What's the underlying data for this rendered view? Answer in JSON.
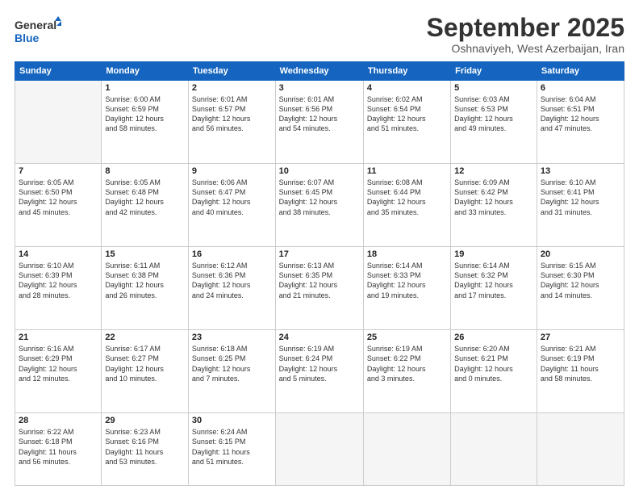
{
  "header": {
    "logo_line1": "General",
    "logo_line2": "Blue",
    "month": "September 2025",
    "location": "Oshnaviyeh, West Azerbaijan, Iran"
  },
  "weekdays": [
    "Sunday",
    "Monday",
    "Tuesday",
    "Wednesday",
    "Thursday",
    "Friday",
    "Saturday"
  ],
  "weeks": [
    [
      {
        "day": "",
        "info": ""
      },
      {
        "day": "1",
        "info": "Sunrise: 6:00 AM\nSunset: 6:59 PM\nDaylight: 12 hours\nand 58 minutes."
      },
      {
        "day": "2",
        "info": "Sunrise: 6:01 AM\nSunset: 6:57 PM\nDaylight: 12 hours\nand 56 minutes."
      },
      {
        "day": "3",
        "info": "Sunrise: 6:01 AM\nSunset: 6:56 PM\nDaylight: 12 hours\nand 54 minutes."
      },
      {
        "day": "4",
        "info": "Sunrise: 6:02 AM\nSunset: 6:54 PM\nDaylight: 12 hours\nand 51 minutes."
      },
      {
        "day": "5",
        "info": "Sunrise: 6:03 AM\nSunset: 6:53 PM\nDaylight: 12 hours\nand 49 minutes."
      },
      {
        "day": "6",
        "info": "Sunrise: 6:04 AM\nSunset: 6:51 PM\nDaylight: 12 hours\nand 47 minutes."
      }
    ],
    [
      {
        "day": "7",
        "info": "Sunrise: 6:05 AM\nSunset: 6:50 PM\nDaylight: 12 hours\nand 45 minutes."
      },
      {
        "day": "8",
        "info": "Sunrise: 6:05 AM\nSunset: 6:48 PM\nDaylight: 12 hours\nand 42 minutes."
      },
      {
        "day": "9",
        "info": "Sunrise: 6:06 AM\nSunset: 6:47 PM\nDaylight: 12 hours\nand 40 minutes."
      },
      {
        "day": "10",
        "info": "Sunrise: 6:07 AM\nSunset: 6:45 PM\nDaylight: 12 hours\nand 38 minutes."
      },
      {
        "day": "11",
        "info": "Sunrise: 6:08 AM\nSunset: 6:44 PM\nDaylight: 12 hours\nand 35 minutes."
      },
      {
        "day": "12",
        "info": "Sunrise: 6:09 AM\nSunset: 6:42 PM\nDaylight: 12 hours\nand 33 minutes."
      },
      {
        "day": "13",
        "info": "Sunrise: 6:10 AM\nSunset: 6:41 PM\nDaylight: 12 hours\nand 31 minutes."
      }
    ],
    [
      {
        "day": "14",
        "info": "Sunrise: 6:10 AM\nSunset: 6:39 PM\nDaylight: 12 hours\nand 28 minutes."
      },
      {
        "day": "15",
        "info": "Sunrise: 6:11 AM\nSunset: 6:38 PM\nDaylight: 12 hours\nand 26 minutes."
      },
      {
        "day": "16",
        "info": "Sunrise: 6:12 AM\nSunset: 6:36 PM\nDaylight: 12 hours\nand 24 minutes."
      },
      {
        "day": "17",
        "info": "Sunrise: 6:13 AM\nSunset: 6:35 PM\nDaylight: 12 hours\nand 21 minutes."
      },
      {
        "day": "18",
        "info": "Sunrise: 6:14 AM\nSunset: 6:33 PM\nDaylight: 12 hours\nand 19 minutes."
      },
      {
        "day": "19",
        "info": "Sunrise: 6:14 AM\nSunset: 6:32 PM\nDaylight: 12 hours\nand 17 minutes."
      },
      {
        "day": "20",
        "info": "Sunrise: 6:15 AM\nSunset: 6:30 PM\nDaylight: 12 hours\nand 14 minutes."
      }
    ],
    [
      {
        "day": "21",
        "info": "Sunrise: 6:16 AM\nSunset: 6:29 PM\nDaylight: 12 hours\nand 12 minutes."
      },
      {
        "day": "22",
        "info": "Sunrise: 6:17 AM\nSunset: 6:27 PM\nDaylight: 12 hours\nand 10 minutes."
      },
      {
        "day": "23",
        "info": "Sunrise: 6:18 AM\nSunset: 6:25 PM\nDaylight: 12 hours\nand 7 minutes."
      },
      {
        "day": "24",
        "info": "Sunrise: 6:19 AM\nSunset: 6:24 PM\nDaylight: 12 hours\nand 5 minutes."
      },
      {
        "day": "25",
        "info": "Sunrise: 6:19 AM\nSunset: 6:22 PM\nDaylight: 12 hours\nand 3 minutes."
      },
      {
        "day": "26",
        "info": "Sunrise: 6:20 AM\nSunset: 6:21 PM\nDaylight: 12 hours\nand 0 minutes."
      },
      {
        "day": "27",
        "info": "Sunrise: 6:21 AM\nSunset: 6:19 PM\nDaylight: 11 hours\nand 58 minutes."
      }
    ],
    [
      {
        "day": "28",
        "info": "Sunrise: 6:22 AM\nSunset: 6:18 PM\nDaylight: 11 hours\nand 56 minutes."
      },
      {
        "day": "29",
        "info": "Sunrise: 6:23 AM\nSunset: 6:16 PM\nDaylight: 11 hours\nand 53 minutes."
      },
      {
        "day": "30",
        "info": "Sunrise: 6:24 AM\nSunset: 6:15 PM\nDaylight: 11 hours\nand 51 minutes."
      },
      {
        "day": "",
        "info": ""
      },
      {
        "day": "",
        "info": ""
      },
      {
        "day": "",
        "info": ""
      },
      {
        "day": "",
        "info": ""
      }
    ]
  ]
}
